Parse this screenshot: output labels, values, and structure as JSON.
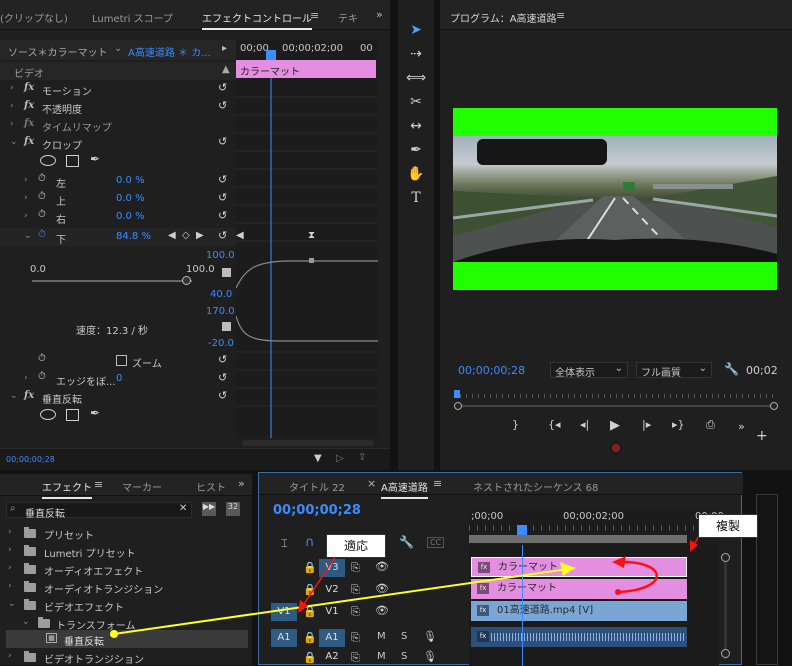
{
  "effect_controls": {
    "tabs": [
      "(クリップなし)",
      "Lumetri スコープ",
      "エフェクトコントロール",
      "テキ"
    ],
    "source": "ソース＊カラーマット",
    "sequence": "A高速道路 ＊ カ...",
    "time_ruler": [
      "00;00",
      "00;00;02;00",
      "00"
    ],
    "clip_name": "カラーマット",
    "section_video": "ビデオ",
    "effects": {
      "motion": "モーション",
      "opacity": "不透明度",
      "time_remap": "タイムリマップ",
      "crop": "クロップ",
      "flip": "垂直反転"
    },
    "crop_params": [
      {
        "label": "左",
        "value": "0.0 %"
      },
      {
        "label": "上",
        "value": "0.0 %"
      },
      {
        "label": "右",
        "value": "0.0 %"
      },
      {
        "label": "下",
        "value": "84.8 %"
      }
    ],
    "graph": {
      "top_value": "100.0",
      "min": "0.0",
      "max": "100.0",
      "low_value": "40.0",
      "vel_top": "170.0",
      "vel_bottom": "-20.0",
      "speed": "速度：12.3 / 秒"
    },
    "zoom_label": "ズーム",
    "edge_feather": {
      "label": "エッジをぼ...",
      "value": "0"
    },
    "timecode": "00;00;00;28"
  },
  "program_monitor": {
    "title": "プログラム：A高速道路",
    "timecode": "00;00;00;28",
    "fit": "全体表示",
    "quality": "フル画質",
    "end_time": "00;02"
  },
  "effects_panel": {
    "tabs": [
      "エフェクト",
      "マーカー",
      "ヒスト"
    ],
    "search_value": "垂直反転",
    "tree": [
      "プリセット",
      "Lumetri プリセット",
      "オーディオエフェクト",
      "オーディオトランジション",
      "ビデオエフェクト",
      "トランスフォーム",
      "垂直反転",
      "ビデオトランジション"
    ]
  },
  "timeline": {
    "tabs": [
      "タイトル 22",
      "A高速道路",
      "ネストされたシーケンス 68"
    ],
    "timecode": "00;00;00;28",
    "ruler": [
      ";00;00",
      "00;00;02;00",
      "00;00"
    ],
    "tracks": [
      "V3",
      "V2",
      "V1",
      "A1",
      "A2"
    ],
    "src_v": "V1",
    "src_a": "A1",
    "clips": {
      "v3": "カラーマット",
      "v2": "カラーマット",
      "v1": "01高速道路.mp4 [V]"
    },
    "track_labels": {
      "m": "M",
      "s": "S"
    }
  },
  "annotations": {
    "apply": "適応",
    "duplicate": "複製"
  },
  "colors": {
    "accent_blue": "#3b8cff",
    "clip_pink": "#e38ee0",
    "clip_video": "#7aa6d6",
    "green_screen": "#22ff00",
    "annotation_red": "#ff1010",
    "annotation_yellow": "#ffff20"
  }
}
